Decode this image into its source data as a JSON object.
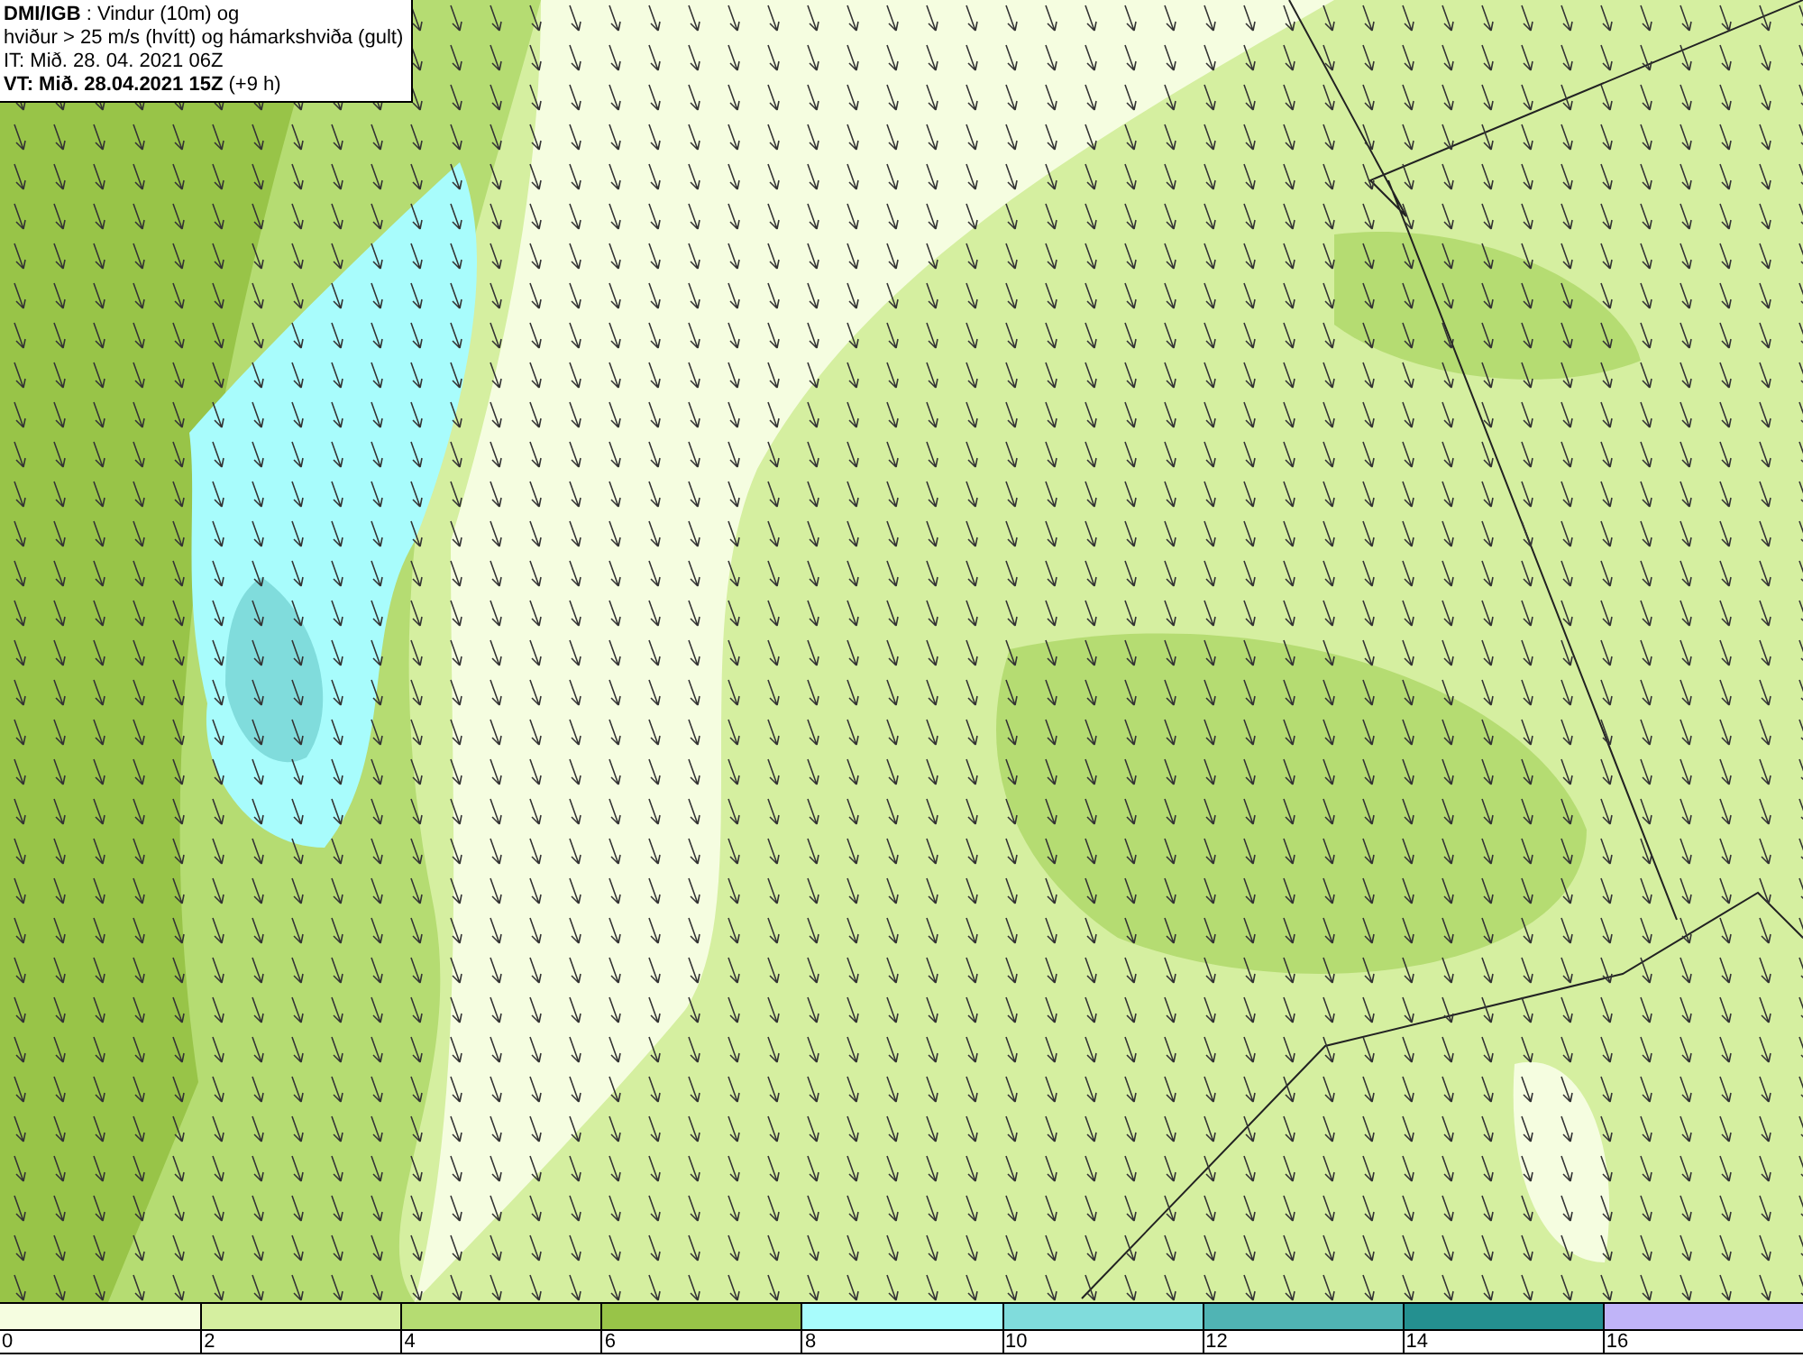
{
  "map": {
    "header": [
      "**DMI/IGB** : Vindur (10m) og",
      "hviður > 25 m/s (hvítt) og hámarkshviða (gult)",
      "IT: Mið. 28. 04. 2021 06Z",
      "**VT: Mið. 28.04.2021 15Z** (+9 h)"
    ]
  },
  "legend": {
    "bins": [
      {
        "color": "#f5fde0",
        "label": "0"
      },
      {
        "color": "#d5efa0",
        "label": "2"
      },
      {
        "color": "#b5dc72",
        "label": "4"
      },
      {
        "color": "#98c448",
        "label": "6"
      },
      {
        "color": "#a8fcfc",
        "label": "8"
      },
      {
        "color": "#80dcdc",
        "label": "10"
      },
      {
        "color": "#50b4b4",
        "label": "12"
      },
      {
        "color": "#249090",
        "label": "14"
      },
      {
        "color": "#c0b4f8",
        "label": "16"
      }
    ]
  }
}
